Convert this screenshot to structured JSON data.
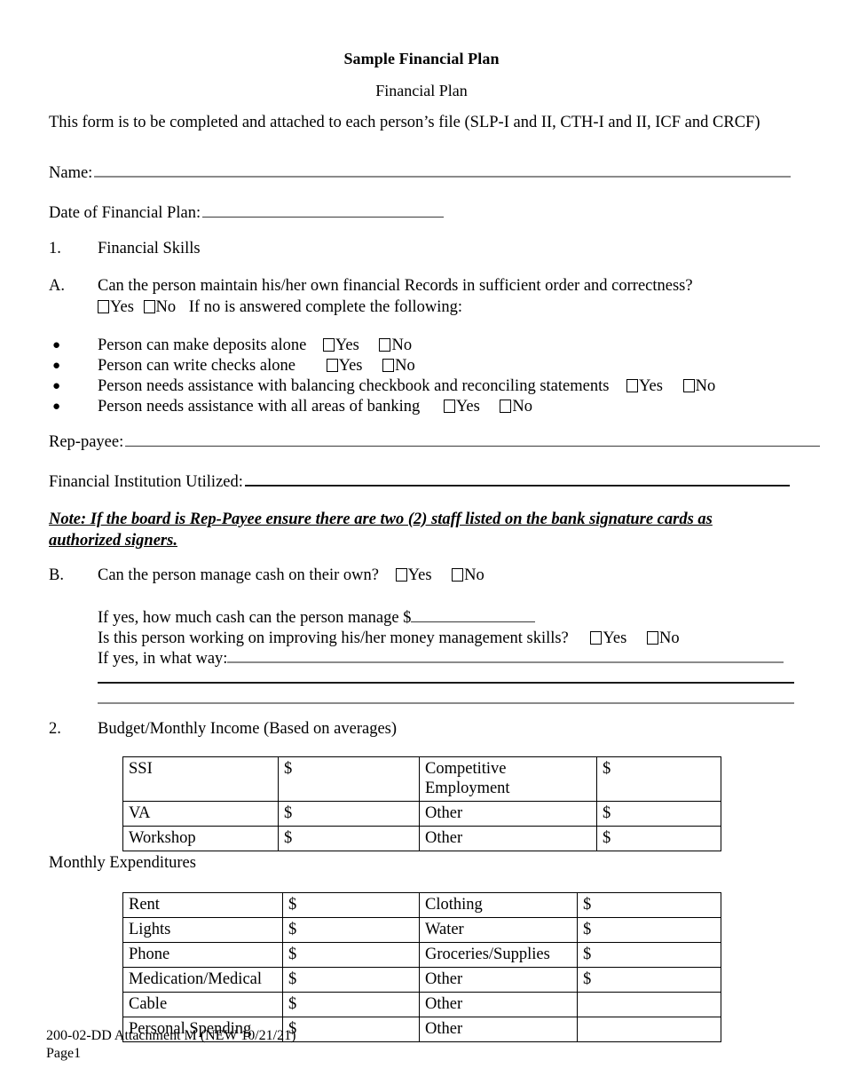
{
  "document": {
    "title": "Sample Financial Plan",
    "subtitle": "Financial Plan",
    "intro": "This form is to be completed and attached to each person’s file (SLP-I and II, CTH-I and II, ICF and CRCF)"
  },
  "fields": {
    "name_label": "Name:",
    "date_label": "Date of Financial Plan:",
    "rep_payee_label": "Rep-payee:",
    "financial_institution_label": "Financial Institution Utilized:"
  },
  "section1": {
    "marker": "1.",
    "title": "Financial Skills",
    "item_a": {
      "marker": "A.",
      "question": "Can the person maintain his/her own financial Records in sufficient order and correctness?",
      "yes_label": "Yes",
      "no_label": "No",
      "followup": "If no is answered complete the following:"
    },
    "bullets": [
      {
        "text": "Person can make deposits alone",
        "yes_label": "Yes",
        "no_label": "No"
      },
      {
        "text": "Person can write checks alone",
        "yes_label": "Yes",
        "no_label": "No"
      },
      {
        "text": "Person needs assistance with balancing checkbook and reconciling statements",
        "yes_label": "Yes",
        "no_label": "No"
      },
      {
        "text": "Person needs assistance with all areas of banking",
        "yes_label": "Yes",
        "no_label": "No"
      }
    ],
    "note": "Note:  If the board is Rep-Payee ensure there are two (2) staff listed on the bank signature cards as authorized signers.",
    "item_b": {
      "marker": "B.",
      "question": "Can the person manage cash on their own?",
      "yes_label": "Yes",
      "no_label": "No",
      "cash_amount_label": "If yes, how much cash can the person manage $",
      "improving_question": "Is this person working on improving his/her money management skills?",
      "improving_yes_label": "Yes",
      "improving_no_label": "No",
      "in_what_way_label": "If yes, in what way:"
    }
  },
  "section2": {
    "marker": "2.",
    "title": "Budget/Monthly Income (Based on averages)",
    "income_rows": [
      {
        "label1": "SSI",
        "value1": "$",
        "label2": "Competitive Employment",
        "value2": "$"
      },
      {
        "label1": "VA",
        "value1": "$",
        "label2": "Other",
        "value2": "$"
      },
      {
        "label1": "Workshop",
        "value1": "$",
        "label2": "Other",
        "value2": "$"
      }
    ],
    "expenditures_title": "Monthly Expenditures",
    "expenditure_rows": [
      {
        "label1": "Rent",
        "value1": "$",
        "label2": "Clothing",
        "value2": "$"
      },
      {
        "label1": "Lights",
        "value1": "$",
        "label2": "Water",
        "value2": "$"
      },
      {
        "label1": "Phone",
        "value1": "$",
        "label2": "Groceries/Supplies",
        "value2": "$"
      },
      {
        "label1": "Medication/Medical",
        "value1": "$",
        "label2": "Other",
        "value2": "$"
      },
      {
        "label1": "Cable",
        "value1": "$",
        "label2": "Other",
        "value2": ""
      },
      {
        "label1": "Personal Spending",
        "value1": "$",
        "label2": "Other",
        "value2": ""
      }
    ]
  },
  "footer": {
    "line1": "200-02-DD Attachment M (NEW 10/21/21)",
    "line2": "Page1"
  }
}
